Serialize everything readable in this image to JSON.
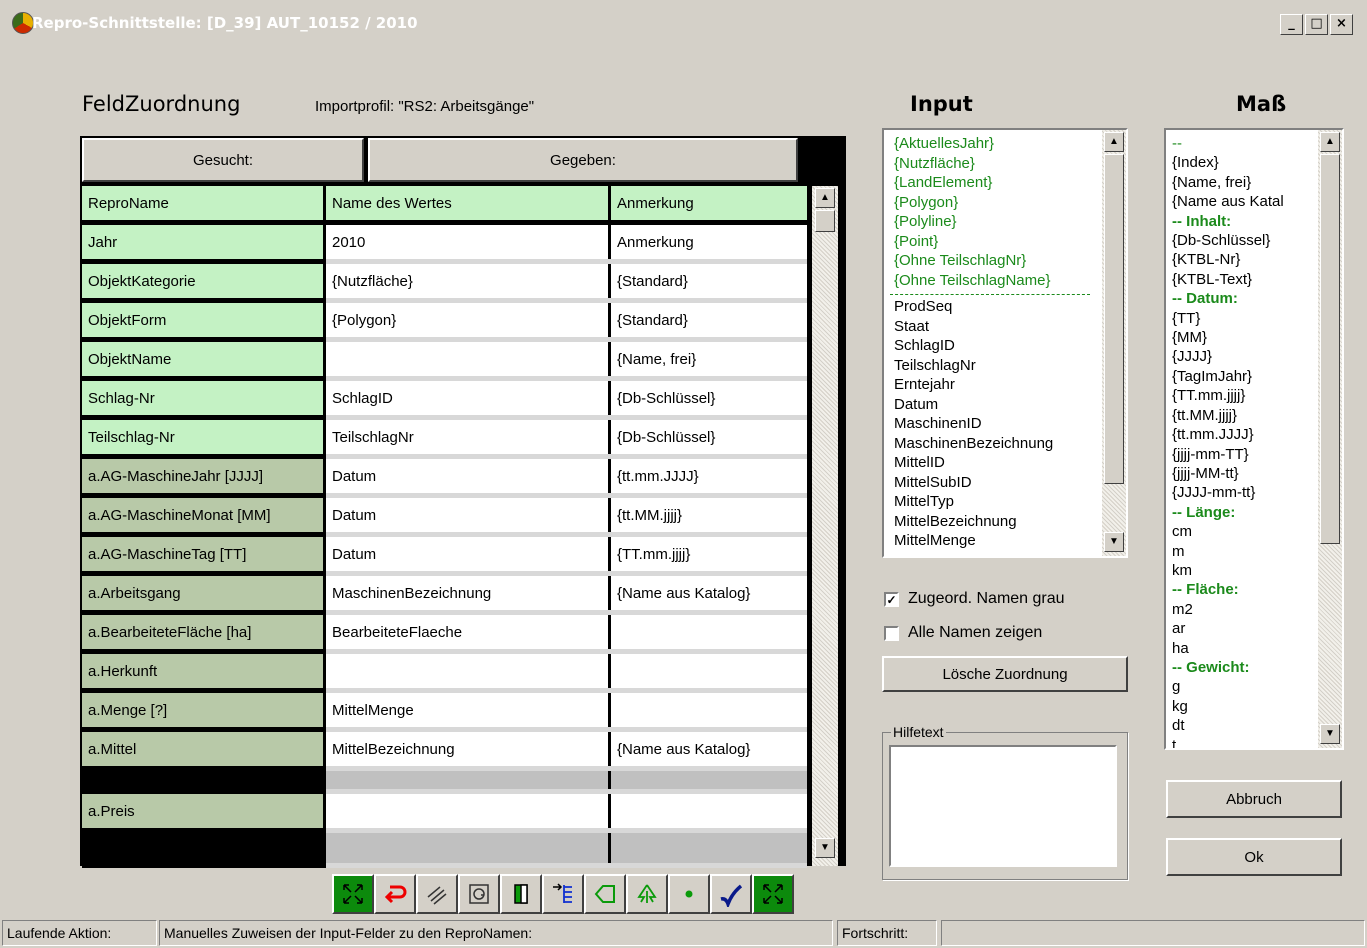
{
  "window": {
    "title": "Repro-Schnittstelle: [D_39] AUT_10152 / 2010",
    "minimize_label": "_",
    "maximize_label": "□",
    "close_label": "×"
  },
  "feld": {
    "heading": "FeldZuordnung",
    "profile": "Importprofil: \"RS2: Arbeitsgänge\"",
    "header_gesucht": "Gesucht:",
    "header_gegeben": "Gegeben:",
    "columns": [
      "ReproName",
      "Name des Wertes",
      "Anmerkung"
    ],
    "rows": [
      [
        "Jahr",
        "2010",
        "Anmerkung"
      ],
      [
        "ObjektKategorie",
        "{Nutzfläche}",
        "{Standard}"
      ],
      [
        "ObjektForm",
        "{Polygon}",
        "{Standard}"
      ],
      [
        "ObjektName",
        "",
        "{Name, frei}"
      ],
      [
        "Schlag-Nr",
        "SchlagID",
        "{Db-Schlüssel}"
      ],
      [
        "Teilschlag-Nr",
        "TeilschlagNr",
        "{Db-Schlüssel}"
      ],
      [
        "a.AG-MaschineJahr [JJJJ]",
        "Datum",
        "{tt.mm.JJJJ}"
      ],
      [
        "a.AG-MaschineMonat [MM]",
        "Datum",
        "{tt.MM.jjjj}"
      ],
      [
        "a.AG-MaschineTag [TT]",
        "Datum",
        "{TT.mm.jjjj}"
      ],
      [
        "a.Arbeitsgang",
        "MaschinenBezeichnung",
        "{Name aus Katalog}"
      ],
      [
        "a.BearbeiteteFläche [ha]",
        "BearbeiteteFlaeche",
        ""
      ],
      [
        "a.Herkunft",
        "",
        ""
      ],
      [
        "a.Menge [?]",
        "MittelMenge",
        ""
      ],
      [
        "a.Mittel",
        "MittelBezeichnung",
        "{Name aus Katalog}"
      ],
      [
        "a.Preis",
        "",
        ""
      ]
    ]
  },
  "input": {
    "heading": "Input",
    "assigned_items": [
      "{AktuellesJahr}",
      "{Nutzfläche}",
      "{LandElement}",
      "{Polygon}",
      "{Polyline}",
      "{Point}",
      "{Ohne TeilschlagNr}",
      "{Ohne TeilschlagName}"
    ],
    "items": [
      "ProdSeq",
      "Staat",
      "SchlagID",
      "TeilschlagNr",
      "Erntejahr",
      "Datum",
      "MaschinenID",
      "MaschinenBezeichnung",
      "MittelID",
      "MittelSubID",
      "MittelTyp",
      "MittelBezeichnung",
      "MittelMenge"
    ]
  },
  "mass": {
    "heading": "Maß",
    "items": [
      {
        "t": "--",
        "s": "green"
      },
      {
        "t": "{Index}"
      },
      {
        "t": "{Name, frei}"
      },
      {
        "t": "{Name aus Katal"
      },
      {
        "t": "-- Inhalt:",
        "s": "bold"
      },
      {
        "t": "{Db-Schlüssel}"
      },
      {
        "t": "{KTBL-Nr}"
      },
      {
        "t": "{KTBL-Text}"
      },
      {
        "t": "-- Datum:",
        "s": "bold"
      },
      {
        "t": "{TT}"
      },
      {
        "t": "{MM}"
      },
      {
        "t": "{JJJJ}"
      },
      {
        "t": "{TagImJahr}"
      },
      {
        "t": "{TT.mm.jjjj}"
      },
      {
        "t": "{tt.MM.jjjj}"
      },
      {
        "t": "{tt.mm.JJJJ}"
      },
      {
        "t": "{jjjj-mm-TT}"
      },
      {
        "t": "{jjjj-MM-tt}"
      },
      {
        "t": "{JJJJ-mm-tt}"
      },
      {
        "t": "-- Länge:",
        "s": "bold"
      },
      {
        "t": "cm"
      },
      {
        "t": "m"
      },
      {
        "t": "km"
      },
      {
        "t": "-- Fläche:",
        "s": "bold"
      },
      {
        "t": "m2"
      },
      {
        "t": "ar"
      },
      {
        "t": "ha"
      },
      {
        "t": "-- Gewicht:",
        "s": "bold"
      },
      {
        "t": "g"
      },
      {
        "t": "kg"
      },
      {
        "t": "dt"
      },
      {
        "t": "t"
      }
    ]
  },
  "options": {
    "grey_names_label": "Zugeord. Namen grau",
    "grey_names_checked": true,
    "show_all_label": "Alle Namen zeigen",
    "show_all_checked": false,
    "delete_label": "Lösche Zuordnung",
    "help_label": "Hilfetext",
    "help_text": ""
  },
  "buttons": {
    "cancel": "Abbruch",
    "ok": "Ok"
  },
  "toolbar": {
    "tools": [
      "zoom-extents-icon",
      "undo-arrow-icon",
      "hatch-lines-icon",
      "label-icon",
      "door-icon",
      "indent-list-icon",
      "polygon-icon",
      "tree-icon",
      "point-icon",
      "checkmark-icon",
      "zoom-extents-icon"
    ]
  },
  "status": {
    "action_label": "Laufende Aktion:",
    "action_text": "Manuelles Zuweisen der Input-Felder zu den ReproNamen:",
    "progress_label": "Fortschritt:",
    "progress": 0
  },
  "colors": {
    "assigned_green": "#1b8a1b",
    "header_green": "#c4f2c4",
    "repro_col": "#b8c9a8",
    "face": "#d4d0c8"
  }
}
